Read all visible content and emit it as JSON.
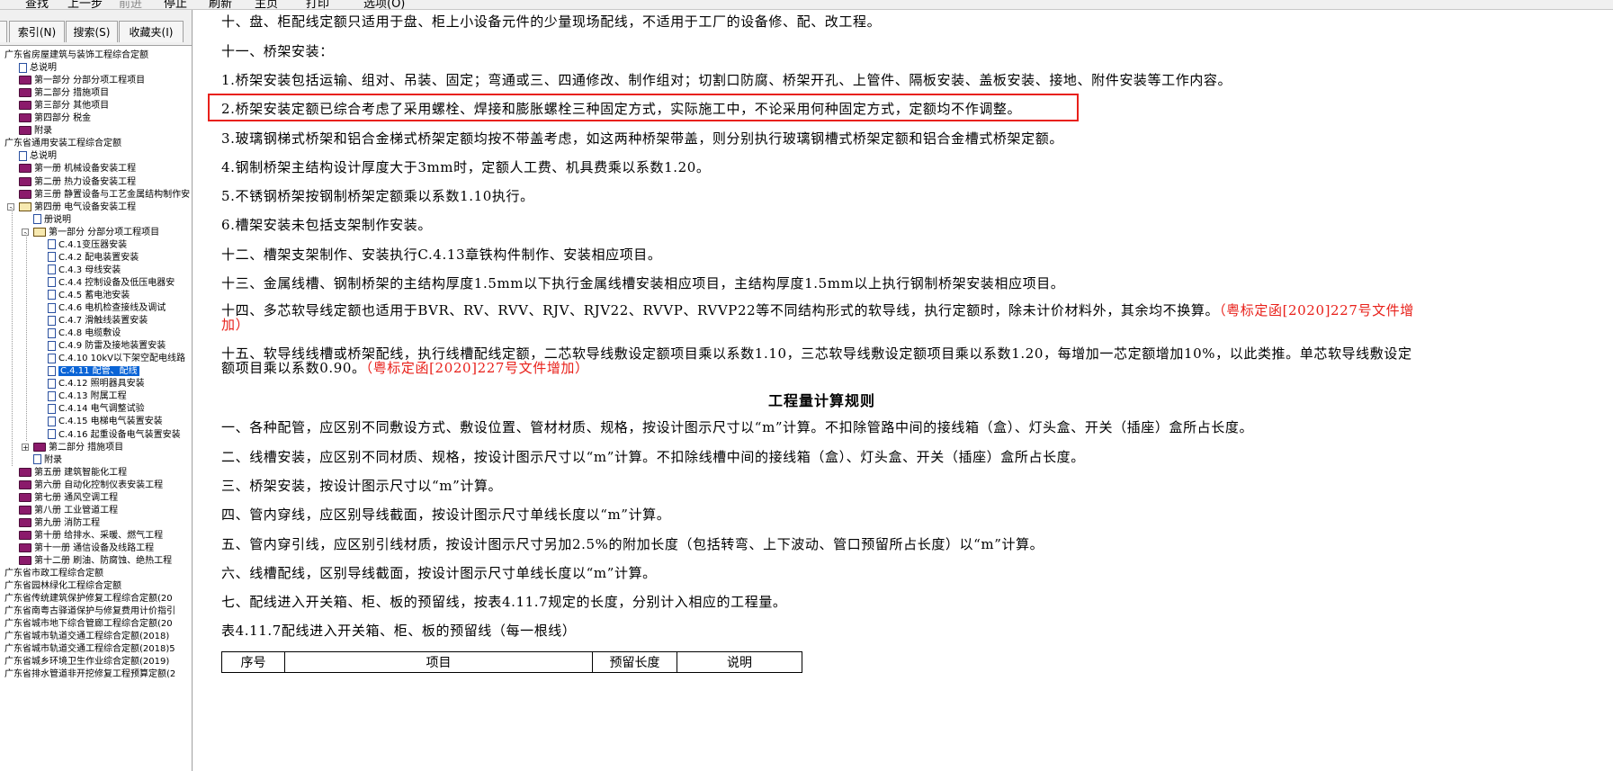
{
  "toolbar": {
    "items": [
      "查找",
      "上一步",
      "前进",
      "停止",
      "刷新",
      "主页",
      "打印",
      "选项(O)"
    ]
  },
  "left_pane": {
    "tabs": [
      "索引(N)",
      "搜索(S)",
      "收藏夹(I)"
    ],
    "tree": [
      {
        "label": "广东省房屋建筑与装饰工程综合定额",
        "icon": "none"
      },
      {
        "label": "总说明",
        "icon": "page-icon"
      },
      {
        "label": "第一部分 分部分项工程项目",
        "icon": "book-icon"
      },
      {
        "label": "第二部分 措施项目",
        "icon": "book-icon"
      },
      {
        "label": "第三部分 其他项目",
        "icon": "book-icon"
      },
      {
        "label": "第四部分 税金",
        "icon": "book-icon"
      },
      {
        "label": "附录",
        "icon": "book-icon"
      },
      {
        "label": "广东省通用安装工程综合定额",
        "icon": "none"
      },
      {
        "label": "总说明",
        "icon": "page-icon"
      },
      {
        "label": "第一册 机械设备安装工程",
        "icon": "book-icon"
      },
      {
        "label": "第二册 热力设备安装工程",
        "icon": "book-icon"
      },
      {
        "label": "第三册 静置设备与工艺金属结构制作安",
        "icon": "book-icon"
      },
      {
        "label": "第四册 电气设备安装工程",
        "icon": "openbook-icon"
      },
      {
        "label": "册说明",
        "icon": "page-icon"
      },
      {
        "label": "第一部分 分部分项工程项目",
        "icon": "openbook-icon"
      },
      {
        "label": "C.4.1变压器安装",
        "icon": "page-icon"
      },
      {
        "label": "C.4.2 配电装置安装",
        "icon": "page-icon"
      },
      {
        "label": "C.4.3 母线安装",
        "icon": "page-icon"
      },
      {
        "label": "C.4.4 控制设备及低压电器安",
        "icon": "page-icon"
      },
      {
        "label": "C.4.5 蓄电池安装",
        "icon": "page-icon"
      },
      {
        "label": "C.4.6 电机检查接线及调试",
        "icon": "page-icon"
      },
      {
        "label": "C.4.7 滑触线装置安装",
        "icon": "page-icon"
      },
      {
        "label": "C.4.8 电缆敷设",
        "icon": "page-icon"
      },
      {
        "label": "C.4.9 防雷及接地装置安装",
        "icon": "page-icon"
      },
      {
        "label": "C.4.10 10kV以下架空配电线路",
        "icon": "page-icon"
      },
      {
        "label": "C.4.11 配管、配线",
        "icon": "page-icon",
        "selected": true
      },
      {
        "label": "C.4.12 照明器具安装",
        "icon": "page-icon"
      },
      {
        "label": "C.4.13 附属工程",
        "icon": "page-icon"
      },
      {
        "label": "C.4.14 电气调整试验",
        "icon": "page-icon"
      },
      {
        "label": "C.4.15 电梯电气装置安装",
        "icon": "page-icon"
      },
      {
        "label": "C.4.16 起重设备电气装置安装",
        "icon": "page-icon"
      },
      {
        "label": "第二部分 措施项目",
        "icon": "book-icon"
      },
      {
        "label": "附录",
        "icon": "page-icon"
      },
      {
        "label": "第五册 建筑智能化工程",
        "icon": "book-icon"
      },
      {
        "label": "第六册 自动化控制仪表安装工程",
        "icon": "book-icon"
      },
      {
        "label": "第七册 通风空调工程",
        "icon": "book-icon"
      },
      {
        "label": "第八册 工业管道工程",
        "icon": "book-icon"
      },
      {
        "label": "第九册 消防工程",
        "icon": "book-icon"
      },
      {
        "label": "第十册 给排水、采暖、燃气工程",
        "icon": "book-icon"
      },
      {
        "label": "第十一册 通信设备及线路工程",
        "icon": "book-icon"
      },
      {
        "label": "第十二册 刷油、防腐蚀、绝热工程",
        "icon": "book-icon"
      },
      {
        "label": "广东省市政工程综合定额",
        "icon": "none"
      },
      {
        "label": "广东省园林绿化工程综合定额",
        "icon": "none"
      },
      {
        "label": "广东省传统建筑保护修复工程综合定额(20",
        "icon": "none"
      },
      {
        "label": "广东省南粤古驿道保护与修复费用计价指引",
        "icon": "none"
      },
      {
        "label": "广东省城市地下综合管廊工程综合定额(20",
        "icon": "none"
      },
      {
        "label": "广东省城市轨道交通工程综合定额(2018)",
        "icon": "none"
      },
      {
        "label": "广东省城市轨道交通工程综合定额(2018)5",
        "icon": "none"
      },
      {
        "label": "广东省城乡环境卫生作业综合定额(2019)",
        "icon": "none"
      },
      {
        "label": "广东省排水管道非开挖修复工程预算定额(2",
        "icon": "none"
      }
    ]
  },
  "content": {
    "paragraphs": [
      {
        "text": "十、盘、柜配线定额只适用于盘、柜上小设备元件的少量现场配线，不适用于工厂的设备修、配、改工程。",
        "red": ""
      },
      {
        "text": "十一、桥架安装：",
        "red": ""
      },
      {
        "text": "1.桥架安装包括运输、组对、吊装、固定；弯通或三、四通修改、制作组对；切割口防腐、桥架开孔、上管件、隔板安装、盖板安装、接地、附件安装等工作内容。",
        "red": ""
      },
      {
        "text": "2.桥架安装定额已综合考虑了采用螺栓、焊接和膨胀螺栓三种固定方式，实际施工中，不论采用何种固定方式，定额均不作调整。",
        "red": ""
      },
      {
        "text": "3.玻璃钢梯式桥架和铝合金梯式桥架定额均按不带盖考虑，如这两种桥架带盖，则分别执行玻璃钢槽式桥架定额和铝合金槽式桥架定额。",
        "red": ""
      },
      {
        "text": "4.钢制桥架主结构设计厚度大于3mm时，定额人工费、机具费乘以系数1.20。",
        "red": ""
      },
      {
        "text": "5.不锈钢桥架按钢制桥架定额乘以系数1.10执行。",
        "red": ""
      },
      {
        "text": "6.槽架安装未包括支架制作安装。",
        "red": ""
      },
      {
        "text": "十二、槽架支架制作、安装执行C.4.13章铁构件制作、安装相应项目。",
        "red": ""
      },
      {
        "text": "十三、金属线槽、钢制桥架的主结构厚度1.5mm以下执行金属线槽安装相应项目，主结构厚度1.5mm以上执行钢制桥架安装相应项目。",
        "red": ""
      },
      {
        "text": "十四、多芯软导线定额也适用于BVR、RV、RVV、RJV、RJV22、RVVP、RVVP22等不同结构形式的软导线，执行定额时，除未计价材料外，其余均不换算。",
        "red": "（粤标定函[2020]227号文件增加）"
      },
      {
        "text": "十五、软导线线槽或桥架配线，执行线槽配线定额，二芯软导线敷设定额项目乘以系数1.10，三芯软导线敷设定额项目乘以系数1.20，每增加一芯定额增加10%，以此类推。单芯软导线敷设定额项目乘以系数0.90。",
        "red": "（粤标定函[2020]227号文件增加）"
      }
    ],
    "heading": "工程量计算规则",
    "rules": [
      "一、各种配管，应区别不同敷设方式、敷设位置、管材材质、规格，按设计图示尺寸以“m”计算。不扣除管路中间的接线箱（盒）、灯头盒、开关（插座）盒所占长度。",
      "二、线槽安装，应区别不同材质、规格，按设计图示尺寸以“m”计算。不扣除线槽中间的接线箱（盒）、灯头盒、开关（插座）盒所占长度。",
      "三、桥架安装，按设计图示尺寸以“m”计算。",
      "四、管内穿线，应区别导线截面，按设计图示尺寸单线长度以“m”计算。",
      "五、管内穿引线，应区别引线材质，按设计图示尺寸另加2.5%的附加长度（包括转弯、上下波动、管口预留所占长度）以“m”计算。",
      "六、线槽配线，区别导线截面，按设计图示尺寸单线长度以“m”计算。",
      "七、配线进入开关箱、柜、板的预留线，按表4.11.7规定的长度，分别计入相应的工程量。"
    ],
    "table_caption": "表4.11.7配线进入开关箱、柜、板的预留线（每一根线）",
    "table_headers": [
      "序号",
      "项目",
      "预留长度",
      "说明"
    ]
  }
}
